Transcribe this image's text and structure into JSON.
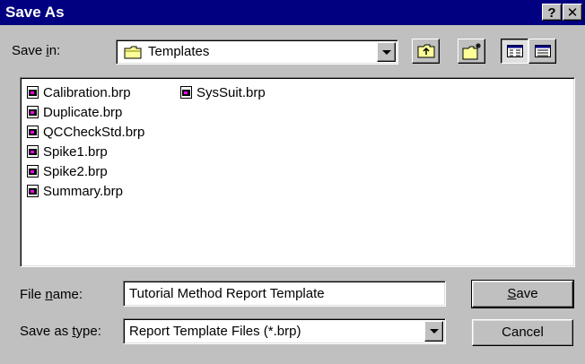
{
  "window": {
    "title": "Save As",
    "help_label": "?",
    "close_label": "✕"
  },
  "save_in": {
    "label_pre": "Save ",
    "label_key": "i",
    "label_post": "n:",
    "value": "Templates",
    "icon": "folder-icon"
  },
  "toolbar": {
    "up_one_level_icon": "up-folder-icon",
    "new_folder_icon": "new-folder-icon",
    "list_view_icon": "list-view-icon",
    "details_view_icon": "details-view-icon"
  },
  "files": [
    "Calibration.brp",
    "Duplicate.brp",
    "QCCheckStd.brp",
    "Spike1.brp",
    "Spike2.brp",
    "Summary.brp",
    "SysSuit.brp"
  ],
  "file_name": {
    "label_pre": "File ",
    "label_key": "n",
    "label_post": "ame:",
    "value": "Tutorial Method Report Template"
  },
  "save_as_type": {
    "label_pre": "Save as ",
    "label_key": "t",
    "label_post": "ype:",
    "value": "Report Template Files (*.brp)"
  },
  "buttons": {
    "save_key": "S",
    "save_rest": "ave",
    "cancel": "Cancel"
  }
}
